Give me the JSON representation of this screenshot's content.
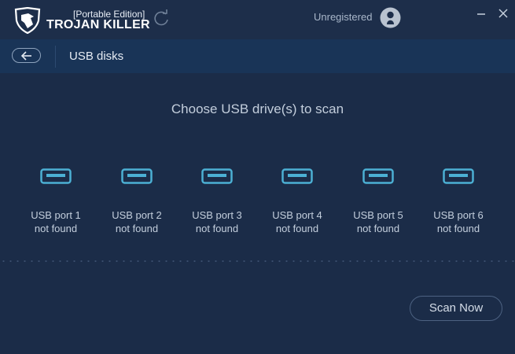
{
  "app": {
    "edition": "[Portable Edition]",
    "brand": "TROJAN KILLER",
    "registration_status": "Unregistered"
  },
  "nav": {
    "title": "USB disks"
  },
  "main": {
    "heading": "Choose USB drive(s) to scan",
    "ports": [
      {
        "label": "USB port 1",
        "status": "not found"
      },
      {
        "label": "USB port 2",
        "status": "not found"
      },
      {
        "label": "USB port 3",
        "status": "not found"
      },
      {
        "label": "USB port 4",
        "status": "not found"
      },
      {
        "label": "USB port 5",
        "status": "not found"
      },
      {
        "label": "USB port 6",
        "status": "not found"
      }
    ]
  },
  "actions": {
    "scan_label": "Scan Now"
  },
  "colors": {
    "background": "#1b2c48",
    "navbar": "#193457",
    "usb_accent": "#4cb0d4"
  },
  "icons": [
    "shield-logo-icon",
    "refresh-icon",
    "user-icon",
    "minimize-icon",
    "close-icon",
    "back-arrow-icon",
    "usb-port-icon"
  ]
}
